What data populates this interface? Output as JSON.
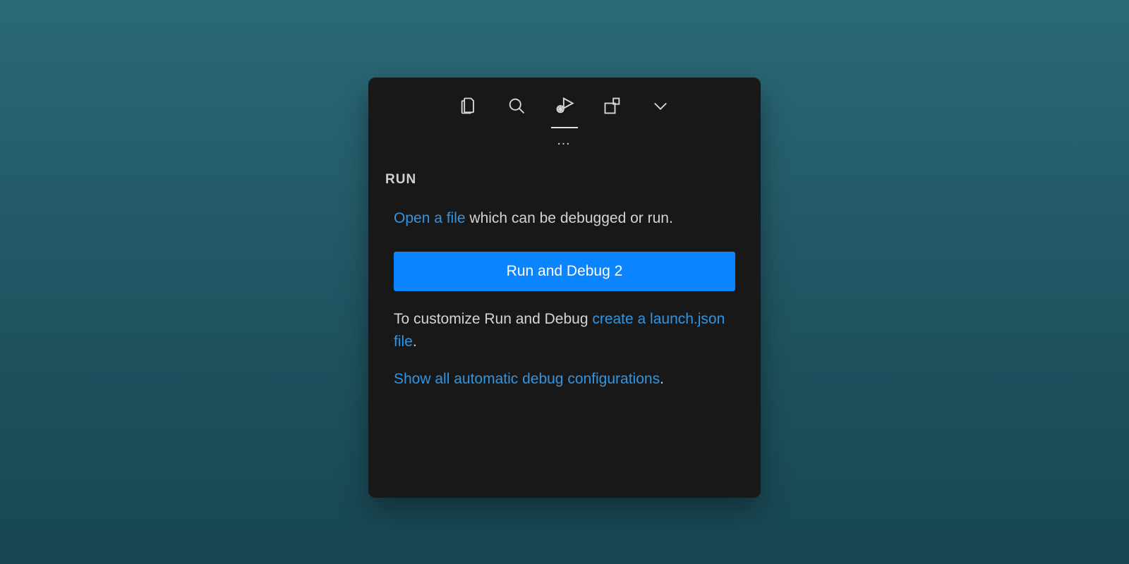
{
  "tabs": {
    "files": "files-icon",
    "search": "search-icon",
    "run_debug": "run-debug-icon",
    "extensions": "extensions-icon",
    "more": "chevron-down-icon"
  },
  "ellipsis": "…",
  "section": {
    "title": "Run"
  },
  "run_panel": {
    "open_file_link": "Open a file",
    "open_file_tail": " which can be debugged or run.",
    "run_button": "Run and Debug 2",
    "customize_lead": "To customize Run and Debug ",
    "create_launch_link": "create a launch.json file",
    "customize_tail": ".",
    "show_configs_link": "Show all automatic debug configurations",
    "show_configs_tail": "."
  }
}
